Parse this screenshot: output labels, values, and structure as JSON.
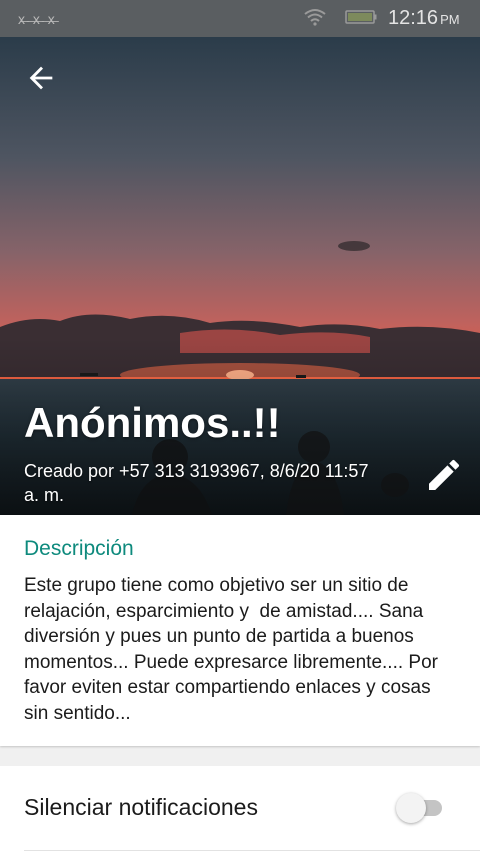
{
  "status_bar": {
    "carrier": "x̶ ̶x̶ ̶x̶",
    "time": "12:16",
    "ampm": "PM"
  },
  "header": {
    "group_name": "Anónimos..!!",
    "created_by": "Creado por +57 313 3193967, 8/6/20 11:57 a. m."
  },
  "description": {
    "label": "Descripción",
    "text": "Este grupo tiene como objetivo ser un sitio de relajación, esparcimiento y  de amistad.... Sana diversión y pues un punto de partida a buenos momentos... Puede expresarce libremente.... Por favor eviten estar compartiendo enlaces y cosas sin sentido..."
  },
  "mute": {
    "label": "Silenciar notificaciones",
    "enabled": false
  },
  "colors": {
    "accent": "#0e8a7d",
    "status_bar": "#5a5e61",
    "sky_top": "#2a3d4c",
    "sunset": "#ff5a3c",
    "sea": "#1c2a33"
  },
  "icons": {
    "back": "arrow-left-icon",
    "edit": "pencil-icon",
    "wifi": "wifi-icon",
    "battery": "battery-icon"
  }
}
